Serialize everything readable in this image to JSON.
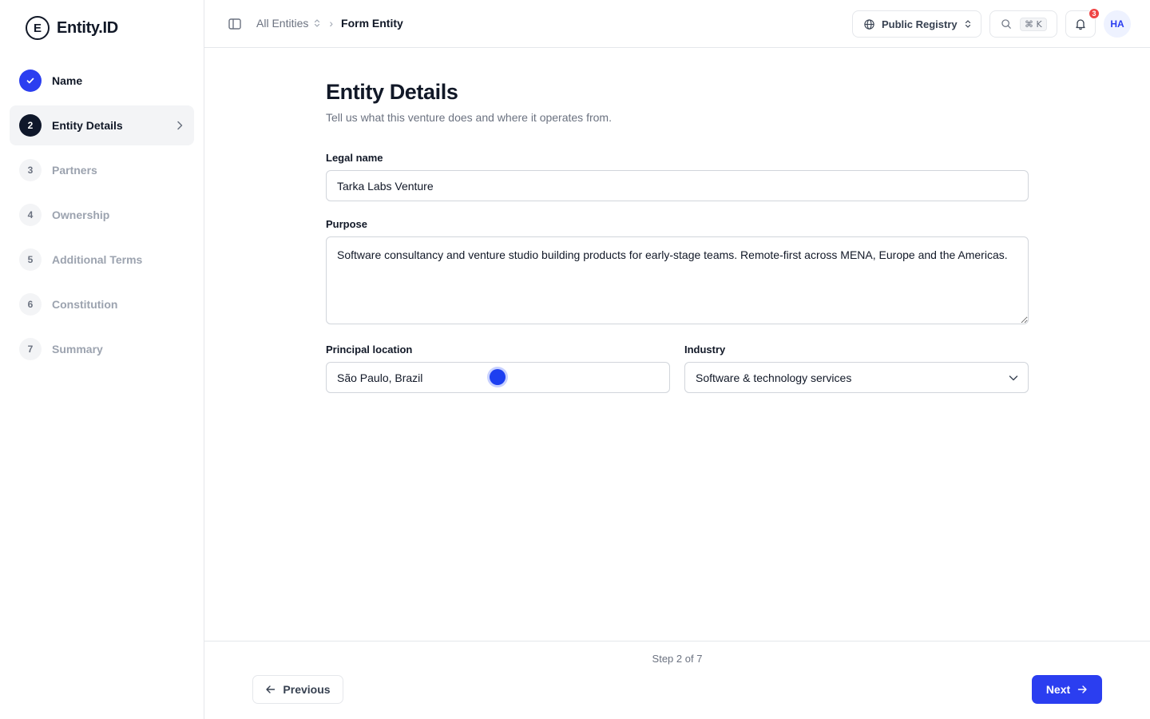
{
  "app": {
    "logo_letter": "E",
    "name": "Entity.ID"
  },
  "colors": {
    "accent": "#2b3ef0",
    "current_step": "#0f172a",
    "notification": "#ef4444"
  },
  "steps": [
    {
      "number": "1",
      "label": "Name",
      "state": "done",
      "icon": "check-icon"
    },
    {
      "number": "2",
      "label": "Entity Details",
      "state": "current"
    },
    {
      "number": "3",
      "label": "Partners",
      "state": "pending"
    },
    {
      "number": "4",
      "label": "Ownership",
      "state": "pending"
    },
    {
      "number": "5",
      "label": "Additional Terms",
      "state": "pending"
    },
    {
      "number": "6",
      "label": "Constitution",
      "state": "pending"
    },
    {
      "number": "7",
      "label": "Summary",
      "state": "pending"
    }
  ],
  "header": {
    "breadcrumb_root": "All Entities",
    "breadcrumb_current": "Form Entity",
    "registry_label": "Public Registry",
    "search_shortcut": "⌘ K",
    "notification_count": "3",
    "avatar_initials": "HA"
  },
  "form": {
    "title": "Entity Details",
    "subtitle": "Tell us what this venture does and where it operates from.",
    "legal_name_label": "Legal name",
    "legal_name_value": "Tarka Labs Venture",
    "purpose_label": "Purpose",
    "purpose_value": "Software consultancy and venture studio building products for early-stage teams. Remote-first across MENA, Europe and the Americas.",
    "location_label": "Principal location",
    "location_value": "São Paulo, Brazil",
    "industry_label": "Industry",
    "industry_value": "Software & technology services"
  },
  "footer": {
    "step_indicator": "Step 2 of 7",
    "previous_label": "Previous",
    "next_label": "Next"
  }
}
